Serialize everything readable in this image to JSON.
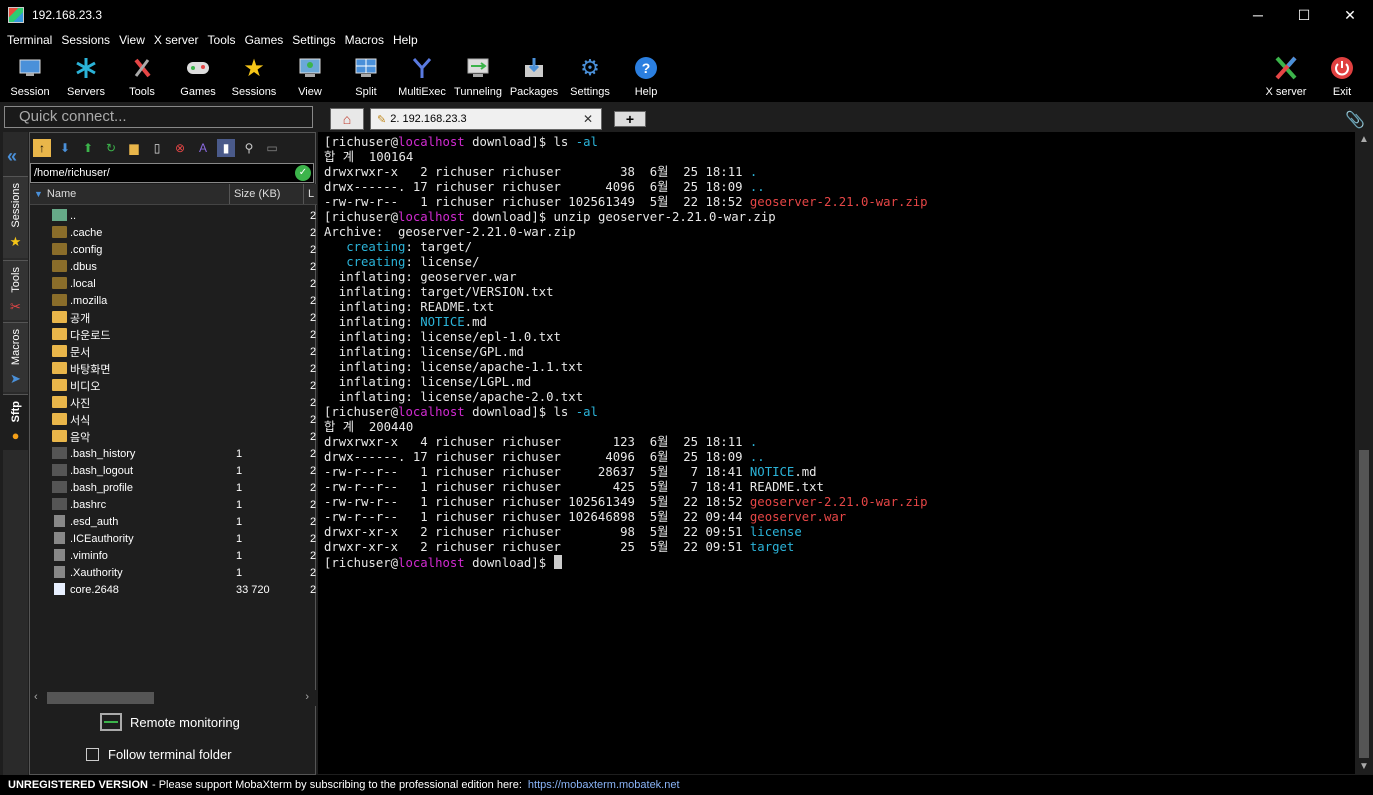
{
  "window": {
    "title": "192.168.23.3"
  },
  "menu": [
    "Terminal",
    "Sessions",
    "View",
    "X server",
    "Tools",
    "Games",
    "Settings",
    "Macros",
    "Help"
  ],
  "toolbar": {
    "buttons": [
      {
        "label": "Session",
        "icon": "session-icon",
        "color": "#4a90d9"
      },
      {
        "label": "Servers",
        "icon": "servers-icon",
        "color": "#2bb3d8"
      },
      {
        "label": "Tools",
        "icon": "tools-icon",
        "color": "#e64646"
      },
      {
        "label": "Games",
        "icon": "games-icon",
        "color": "#cccccc"
      },
      {
        "label": "Sessions",
        "icon": "star-icon",
        "color": "#f5c518"
      },
      {
        "label": "View",
        "icon": "view-icon",
        "color": "#6aa8d8"
      },
      {
        "label": "Split",
        "icon": "split-icon",
        "color": "#4a90d9"
      },
      {
        "label": "MultiExec",
        "icon": "multiexec-icon",
        "color": "#5a7ae0"
      },
      {
        "label": "Tunneling",
        "icon": "tunneling-icon",
        "color": "#3cb44b"
      },
      {
        "label": "Packages",
        "icon": "packages-icon",
        "color": "#6aa8d8"
      },
      {
        "label": "Settings",
        "icon": "gear-icon",
        "color": "#4a90d9"
      },
      {
        "label": "Help",
        "icon": "help-icon",
        "color": "#2b7fe0"
      }
    ],
    "xserver_label": "X server",
    "exit_label": "Exit"
  },
  "quick_connect": {
    "placeholder": "Quick connect..."
  },
  "tabs": {
    "session_label": "2. 192.168.23.3"
  },
  "rail": {
    "sessions": "Sessions",
    "tools": "Tools",
    "macros": "Macros",
    "sftp": "Sftp"
  },
  "sftp": {
    "path": "/home/richuser/",
    "columns": {
      "name": "Name",
      "size": "Size (KB)",
      "extra": "L"
    },
    "files": [
      {
        "name": "..",
        "size": "",
        "type": "parent"
      },
      {
        "name": ".cache",
        "size": "",
        "type": "folder-dark"
      },
      {
        "name": ".config",
        "size": "",
        "type": "folder-dark"
      },
      {
        "name": ".dbus",
        "size": "",
        "type": "folder-dark"
      },
      {
        "name": ".local",
        "size": "",
        "type": "folder-dark"
      },
      {
        "name": ".mozilla",
        "size": "",
        "type": "folder-dark"
      },
      {
        "name": "공개",
        "size": "",
        "type": "folder"
      },
      {
        "name": "다운로드",
        "size": "",
        "type": "folder"
      },
      {
        "name": "문서",
        "size": "",
        "type": "folder"
      },
      {
        "name": "바탕화면",
        "size": "",
        "type": "folder"
      },
      {
        "name": "비디오",
        "size": "",
        "type": "folder"
      },
      {
        "name": "사진",
        "size": "",
        "type": "folder"
      },
      {
        "name": "서식",
        "size": "",
        "type": "folder"
      },
      {
        "name": "음악",
        "size": "",
        "type": "folder"
      },
      {
        "name": ".bash_history",
        "size": "1",
        "type": "file-dark"
      },
      {
        "name": ".bash_logout",
        "size": "1",
        "type": "file-dark"
      },
      {
        "name": ".bash_profile",
        "size": "1",
        "type": "file-dark"
      },
      {
        "name": ".bashrc",
        "size": "1",
        "type": "file-dark"
      },
      {
        "name": ".esd_auth",
        "size": "1",
        "type": "file-doc"
      },
      {
        "name": ".ICEauthority",
        "size": "1",
        "type": "file-doc"
      },
      {
        "name": ".viminfo",
        "size": "1",
        "type": "file-doc"
      },
      {
        "name": ".Xauthority",
        "size": "1",
        "type": "file-doc"
      },
      {
        "name": "core.2648",
        "size": "33 720",
        "type": "file-white"
      }
    ],
    "extra_col": "2",
    "remote_monitoring": "Remote monitoring",
    "follow_folder": "Follow terminal folder"
  },
  "terminal": {
    "prompt_user": "richuser",
    "prompt_host": "localhost",
    "lines": [
      [
        {
          "t": "[",
          "c": ""
        },
        {
          "t": "richuser",
          "c": ""
        },
        {
          "t": "@",
          "c": ""
        },
        {
          "t": "localhost",
          "c": "mag"
        },
        {
          "t": " download]$ ls ",
          "c": ""
        },
        {
          "t": "-al",
          "c": "cyan"
        }
      ],
      [
        {
          "t": "합 계  100164",
          "c": ""
        }
      ],
      [
        {
          "t": "drwxrwxr-x   2 richuser richuser        38  6월  25 18:11 ",
          "c": ""
        },
        {
          "t": ".",
          "c": "cyan"
        }
      ],
      [
        {
          "t": "drwx------. 17 richuser richuser      4096  6월  25 18:09 ",
          "c": ""
        },
        {
          "t": "..",
          "c": "cyan"
        }
      ],
      [
        {
          "t": "-rw-rw-r--   1 richuser richuser 102561349  5월  22 18:52 ",
          "c": ""
        },
        {
          "t": "geoserver-2.21.0-war.zip",
          "c": "red"
        }
      ],
      [
        {
          "t": "[richuser@",
          "c": ""
        },
        {
          "t": "localhost",
          "c": "mag"
        },
        {
          "t": " download]$ unzip geoserver-2.21.0-war.zip",
          "c": ""
        }
      ],
      [
        {
          "t": "Archive:  geoserver-2.21.0-war.zip",
          "c": ""
        }
      ],
      [
        {
          "t": "   ",
          "c": ""
        },
        {
          "t": "creating",
          "c": "cyan"
        },
        {
          "t": ": target/",
          "c": ""
        }
      ],
      [
        {
          "t": "   ",
          "c": ""
        },
        {
          "t": "creating",
          "c": "cyan"
        },
        {
          "t": ": license/",
          "c": ""
        }
      ],
      [
        {
          "t": "  inflating: geoserver.war",
          "c": ""
        }
      ],
      [
        {
          "t": "  inflating: target/VERSION.txt",
          "c": ""
        }
      ],
      [
        {
          "t": "  inflating: README.txt",
          "c": ""
        }
      ],
      [
        {
          "t": "  inflating: ",
          "c": ""
        },
        {
          "t": "NOTICE",
          "c": "cyan"
        },
        {
          "t": ".md",
          "c": ""
        }
      ],
      [
        {
          "t": "  inflating: license/epl-1.0.txt",
          "c": ""
        }
      ],
      [
        {
          "t": "  inflating: license/GPL.md",
          "c": ""
        }
      ],
      [
        {
          "t": "  inflating: license/apache-1.1.txt",
          "c": ""
        }
      ],
      [
        {
          "t": "  inflating: license/LGPL.md",
          "c": ""
        }
      ],
      [
        {
          "t": "  inflating: license/apache-2.0.txt",
          "c": ""
        }
      ],
      [
        {
          "t": "[richuser@",
          "c": ""
        },
        {
          "t": "localhost",
          "c": "mag"
        },
        {
          "t": " download]$ ls ",
          "c": ""
        },
        {
          "t": "-al",
          "c": "cyan"
        }
      ],
      [
        {
          "t": "합 계  200440",
          "c": ""
        }
      ],
      [
        {
          "t": "drwxrwxr-x   4 richuser richuser       123  6월  25 18:11 ",
          "c": ""
        },
        {
          "t": ".",
          "c": "cyan"
        }
      ],
      [
        {
          "t": "drwx------. 17 richuser richuser      4096  6월  25 18:09 ",
          "c": ""
        },
        {
          "t": "..",
          "c": "cyan"
        }
      ],
      [
        {
          "t": "-rw-r--r--   1 richuser richuser     28637  5월   7 18:41 ",
          "c": ""
        },
        {
          "t": "NOTICE",
          "c": "cyan"
        },
        {
          "t": ".md",
          "c": ""
        }
      ],
      [
        {
          "t": "-rw-r--r--   1 richuser richuser       425  5월   7 18:41 README.txt",
          "c": ""
        }
      ],
      [
        {
          "t": "-rw-rw-r--   1 richuser richuser 102561349  5월  22 18:52 ",
          "c": ""
        },
        {
          "t": "geoserver-2.21.0-war.zip",
          "c": "red"
        }
      ],
      [
        {
          "t": "-rw-r--r--   1 richuser richuser 102646898  5월  22 09:44 ",
          "c": ""
        },
        {
          "t": "geoserver.war",
          "c": "red"
        }
      ],
      [
        {
          "t": "drwxr-xr-x   2 richuser richuser        98  5월  22 09:51 ",
          "c": ""
        },
        {
          "t": "license",
          "c": "cyan"
        }
      ],
      [
        {
          "t": "drwxr-xr-x   2 richuser richuser        25  5월  22 09:51 ",
          "c": ""
        },
        {
          "t": "target",
          "c": "cyan"
        }
      ],
      [
        {
          "t": "[richuser@",
          "c": ""
        },
        {
          "t": "localhost",
          "c": "mag"
        },
        {
          "t": " download]$ ",
          "c": ""
        }
      ]
    ]
  },
  "status": {
    "bold": "UNREGISTERED VERSION",
    "text": " -  Please support MobaXterm by subscribing to the professional edition here:",
    "link": "https://mobaxterm.mobatek.net"
  }
}
